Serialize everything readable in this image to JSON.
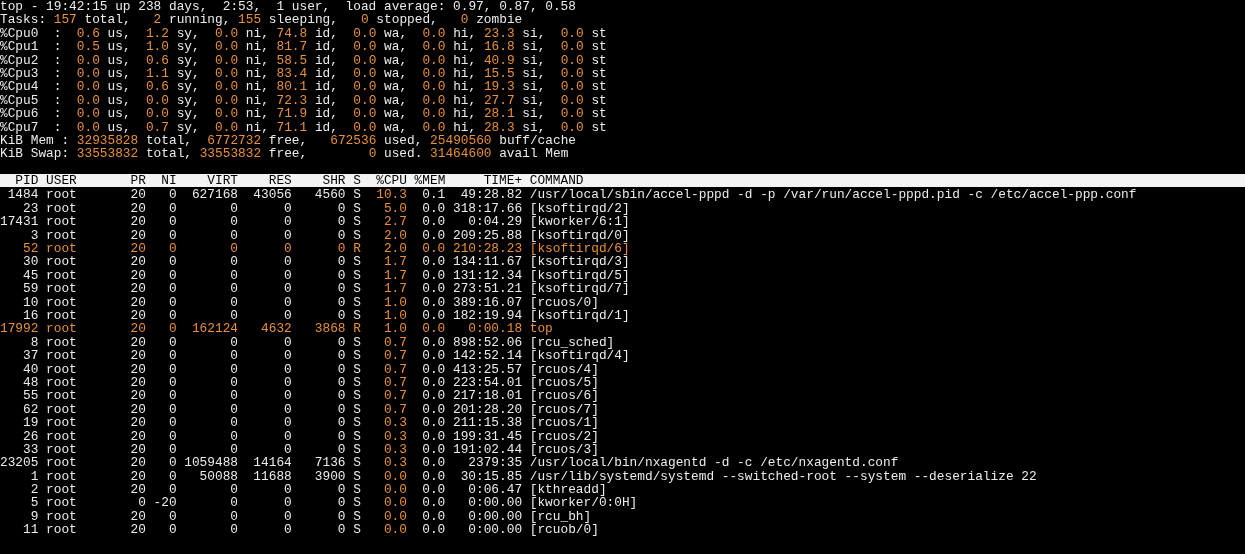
{
  "summary": [
    {
      "parts": [
        {
          "text": "top - 19:42:15 up 238 days,  2:53,  1 user,  load average: 0.97, 0.87, 0.58",
          "highlight": false
        }
      ]
    },
    {
      "parts": [
        {
          "text": "Tasks: ",
          "highlight": false
        },
        {
          "text": "157",
          "highlight": true
        },
        {
          "text": " total,   ",
          "highlight": false
        },
        {
          "text": "2",
          "highlight": true
        },
        {
          "text": " running, ",
          "highlight": false
        },
        {
          "text": "155",
          "highlight": true
        },
        {
          "text": " sleeping,   ",
          "highlight": false
        },
        {
          "text": "0",
          "highlight": true
        },
        {
          "text": " stopped,   ",
          "highlight": false
        },
        {
          "text": "0",
          "highlight": true
        },
        {
          "text": " zombie",
          "highlight": false
        }
      ]
    },
    {
      "parts": [
        {
          "text": "%Cpu0  :  ",
          "highlight": false
        },
        {
          "text": "0.6",
          "highlight": true
        },
        {
          "text": " us,  ",
          "highlight": false
        },
        {
          "text": "1.2",
          "highlight": true
        },
        {
          "text": " sy,  ",
          "highlight": false
        },
        {
          "text": "0.0",
          "highlight": true
        },
        {
          "text": " ni, ",
          "highlight": false
        },
        {
          "text": "74.8",
          "highlight": true
        },
        {
          "text": " id,  ",
          "highlight": false
        },
        {
          "text": "0.0",
          "highlight": true
        },
        {
          "text": " wa,  ",
          "highlight": false
        },
        {
          "text": "0.0",
          "highlight": true
        },
        {
          "text": " hi, ",
          "highlight": false
        },
        {
          "text": "23.3",
          "highlight": true
        },
        {
          "text": " si,  ",
          "highlight": false
        },
        {
          "text": "0.0",
          "highlight": true
        },
        {
          "text": " st",
          "highlight": false
        }
      ]
    },
    {
      "parts": [
        {
          "text": "%Cpu1  :  ",
          "highlight": false
        },
        {
          "text": "0.5",
          "highlight": true
        },
        {
          "text": " us,  ",
          "highlight": false
        },
        {
          "text": "1.0",
          "highlight": true
        },
        {
          "text": " sy,  ",
          "highlight": false
        },
        {
          "text": "0.0",
          "highlight": true
        },
        {
          "text": " ni, ",
          "highlight": false
        },
        {
          "text": "81.7",
          "highlight": true
        },
        {
          "text": " id,  ",
          "highlight": false
        },
        {
          "text": "0.0",
          "highlight": true
        },
        {
          "text": " wa,  ",
          "highlight": false
        },
        {
          "text": "0.0",
          "highlight": true
        },
        {
          "text": " hi, ",
          "highlight": false
        },
        {
          "text": "16.8",
          "highlight": true
        },
        {
          "text": " si,  ",
          "highlight": false
        },
        {
          "text": "0.0",
          "highlight": true
        },
        {
          "text": " st",
          "highlight": false
        }
      ]
    },
    {
      "parts": [
        {
          "text": "%Cpu2  :  ",
          "highlight": false
        },
        {
          "text": "0.0",
          "highlight": true
        },
        {
          "text": " us,  ",
          "highlight": false
        },
        {
          "text": "0.6",
          "highlight": true
        },
        {
          "text": " sy,  ",
          "highlight": false
        },
        {
          "text": "0.0",
          "highlight": true
        },
        {
          "text": " ni, ",
          "highlight": false
        },
        {
          "text": "58.5",
          "highlight": true
        },
        {
          "text": " id,  ",
          "highlight": false
        },
        {
          "text": "0.0",
          "highlight": true
        },
        {
          "text": " wa,  ",
          "highlight": false
        },
        {
          "text": "0.0",
          "highlight": true
        },
        {
          "text": " hi, ",
          "highlight": false
        },
        {
          "text": "40.9",
          "highlight": true
        },
        {
          "text": " si,  ",
          "highlight": false
        },
        {
          "text": "0.0",
          "highlight": true
        },
        {
          "text": " st",
          "highlight": false
        }
      ]
    },
    {
      "parts": [
        {
          "text": "%Cpu3  :  ",
          "highlight": false
        },
        {
          "text": "0.0",
          "highlight": true
        },
        {
          "text": " us,  ",
          "highlight": false
        },
        {
          "text": "1.1",
          "highlight": true
        },
        {
          "text": " sy,  ",
          "highlight": false
        },
        {
          "text": "0.0",
          "highlight": true
        },
        {
          "text": " ni, ",
          "highlight": false
        },
        {
          "text": "83.4",
          "highlight": true
        },
        {
          "text": " id,  ",
          "highlight": false
        },
        {
          "text": "0.0",
          "highlight": true
        },
        {
          "text": " wa,  ",
          "highlight": false
        },
        {
          "text": "0.0",
          "highlight": true
        },
        {
          "text": " hi, ",
          "highlight": false
        },
        {
          "text": "15.5",
          "highlight": true
        },
        {
          "text": " si,  ",
          "highlight": false
        },
        {
          "text": "0.0",
          "highlight": true
        },
        {
          "text": " st",
          "highlight": false
        }
      ]
    },
    {
      "parts": [
        {
          "text": "%Cpu4  :  ",
          "highlight": false
        },
        {
          "text": "0.0",
          "highlight": true
        },
        {
          "text": " us,  ",
          "highlight": false
        },
        {
          "text": "0.6",
          "highlight": true
        },
        {
          "text": " sy,  ",
          "highlight": false
        },
        {
          "text": "0.0",
          "highlight": true
        },
        {
          "text": " ni, ",
          "highlight": false
        },
        {
          "text": "80.1",
          "highlight": true
        },
        {
          "text": " id,  ",
          "highlight": false
        },
        {
          "text": "0.0",
          "highlight": true
        },
        {
          "text": " wa,  ",
          "highlight": false
        },
        {
          "text": "0.0",
          "highlight": true
        },
        {
          "text": " hi, ",
          "highlight": false
        },
        {
          "text": "19.3",
          "highlight": true
        },
        {
          "text": " si,  ",
          "highlight": false
        },
        {
          "text": "0.0",
          "highlight": true
        },
        {
          "text": " st",
          "highlight": false
        }
      ]
    },
    {
      "parts": [
        {
          "text": "%Cpu5  :  ",
          "highlight": false
        },
        {
          "text": "0.0",
          "highlight": true
        },
        {
          "text": " us,  ",
          "highlight": false
        },
        {
          "text": "0.0",
          "highlight": true
        },
        {
          "text": " sy,  ",
          "highlight": false
        },
        {
          "text": "0.0",
          "highlight": true
        },
        {
          "text": " ni, ",
          "highlight": false
        },
        {
          "text": "72.3",
          "highlight": true
        },
        {
          "text": " id,  ",
          "highlight": false
        },
        {
          "text": "0.0",
          "highlight": true
        },
        {
          "text": " wa,  ",
          "highlight": false
        },
        {
          "text": "0.0",
          "highlight": true
        },
        {
          "text": " hi, ",
          "highlight": false
        },
        {
          "text": "27.7",
          "highlight": true
        },
        {
          "text": " si,  ",
          "highlight": false
        },
        {
          "text": "0.0",
          "highlight": true
        },
        {
          "text": " st",
          "highlight": false
        }
      ]
    },
    {
      "parts": [
        {
          "text": "%Cpu6  :  ",
          "highlight": false
        },
        {
          "text": "0.0",
          "highlight": true
        },
        {
          "text": " us,  ",
          "highlight": false
        },
        {
          "text": "0.0",
          "highlight": true
        },
        {
          "text": " sy,  ",
          "highlight": false
        },
        {
          "text": "0.0",
          "highlight": true
        },
        {
          "text": " ni, ",
          "highlight": false
        },
        {
          "text": "71.9",
          "highlight": true
        },
        {
          "text": " id,  ",
          "highlight": false
        },
        {
          "text": "0.0",
          "highlight": true
        },
        {
          "text": " wa,  ",
          "highlight": false
        },
        {
          "text": "0.0",
          "highlight": true
        },
        {
          "text": " hi, ",
          "highlight": false
        },
        {
          "text": "28.1",
          "highlight": true
        },
        {
          "text": " si,  ",
          "highlight": false
        },
        {
          "text": "0.0",
          "highlight": true
        },
        {
          "text": " st",
          "highlight": false
        }
      ]
    },
    {
      "parts": [
        {
          "text": "%Cpu7  :  ",
          "highlight": false
        },
        {
          "text": "0.0",
          "highlight": true
        },
        {
          "text": " us,  ",
          "highlight": false
        },
        {
          "text": "0.7",
          "highlight": true
        },
        {
          "text": " sy,  ",
          "highlight": false
        },
        {
          "text": "0.0",
          "highlight": true
        },
        {
          "text": " ni, ",
          "highlight": false
        },
        {
          "text": "71.1",
          "highlight": true
        },
        {
          "text": " id,  ",
          "highlight": false
        },
        {
          "text": "0.0",
          "highlight": true
        },
        {
          "text": " wa,  ",
          "highlight": false
        },
        {
          "text": "0.0",
          "highlight": true
        },
        {
          "text": " hi, ",
          "highlight": false
        },
        {
          "text": "28.3",
          "highlight": true
        },
        {
          "text": " si,  ",
          "highlight": false
        },
        {
          "text": "0.0",
          "highlight": true
        },
        {
          "text": " st",
          "highlight": false
        }
      ]
    },
    {
      "parts": [
        {
          "text": "KiB Mem : ",
          "highlight": false
        },
        {
          "text": "32935828",
          "highlight": true
        },
        {
          "text": " total,  ",
          "highlight": false
        },
        {
          "text": "6772732",
          "highlight": true
        },
        {
          "text": " free,   ",
          "highlight": false
        },
        {
          "text": "672536",
          "highlight": true
        },
        {
          "text": " used, ",
          "highlight": false
        },
        {
          "text": "25490560",
          "highlight": true
        },
        {
          "text": " buff/cache",
          "highlight": false
        }
      ]
    },
    {
      "parts": [
        {
          "text": "KiB Swap: ",
          "highlight": false
        },
        {
          "text": "33553832",
          "highlight": true
        },
        {
          "text": " total, ",
          "highlight": false
        },
        {
          "text": "33553832",
          "highlight": true
        },
        {
          "text": " free,        ",
          "highlight": false
        },
        {
          "text": "0",
          "highlight": true
        },
        {
          "text": " used. ",
          "highlight": false
        },
        {
          "text": "31464600",
          "highlight": true
        },
        {
          "text": " avail Mem",
          "highlight": false
        }
      ]
    }
  ],
  "table": {
    "columns": [
      {
        "label": "PID",
        "accent": false
      },
      {
        "label": "USER",
        "accent": false
      },
      {
        "label": "PR",
        "accent": false
      },
      {
        "label": "NI",
        "accent": false
      },
      {
        "label": "VIRT",
        "accent": false
      },
      {
        "label": "RES",
        "accent": false
      },
      {
        "label": "SHR",
        "accent": false
      },
      {
        "label": "S",
        "accent": false
      },
      {
        "label": "%CPU",
        "accent": true
      },
      {
        "label": "%MEM",
        "accent": false
      },
      {
        "label": "TIME+",
        "accent": false
      },
      {
        "label": "COMMAND",
        "accent": false
      }
    ],
    "rows": [
      {
        "highlighted": false,
        "cells": [
          "1484",
          "root",
          "20",
          "0",
          "627168",
          "43056",
          "4560",
          "S",
          "10.3",
          "0.1",
          "49:28.82",
          "/usr/local/sbin/accel-pppd -d -p /var/run/accel-pppd.pid -c /etc/accel-ppp.conf"
        ]
      },
      {
        "highlighted": false,
        "cells": [
          "23",
          "root",
          "20",
          "0",
          "0",
          "0",
          "0",
          "S",
          "5.0",
          "0.0",
          "318:17.66",
          "[ksoftirqd/2]"
        ]
      },
      {
        "highlighted": false,
        "cells": [
          "17431",
          "root",
          "20",
          "0",
          "0",
          "0",
          "0",
          "S",
          "2.7",
          "0.0",
          "0:04.29",
          "[kworker/6:1]"
        ]
      },
      {
        "highlighted": false,
        "cells": [
          "3",
          "root",
          "20",
          "0",
          "0",
          "0",
          "0",
          "S",
          "2.0",
          "0.0",
          "209:25.88",
          "[ksoftirqd/0]"
        ]
      },
      {
        "highlighted": true,
        "cells": [
          "52",
          "root",
          "20",
          "0",
          "0",
          "0",
          "0",
          "R",
          "2.0",
          "0.0",
          "210:28.23",
          "[ksoftirqd/6]"
        ]
      },
      {
        "highlighted": false,
        "cells": [
          "30",
          "root",
          "20",
          "0",
          "0",
          "0",
          "0",
          "S",
          "1.7",
          "0.0",
          "134:11.67",
          "[ksoftirqd/3]"
        ]
      },
      {
        "highlighted": false,
        "cells": [
          "45",
          "root",
          "20",
          "0",
          "0",
          "0",
          "0",
          "S",
          "1.7",
          "0.0",
          "131:12.34",
          "[ksoftirqd/5]"
        ]
      },
      {
        "highlighted": false,
        "cells": [
          "59",
          "root",
          "20",
          "0",
          "0",
          "0",
          "0",
          "S",
          "1.7",
          "0.0",
          "273:51.21",
          "[ksoftirqd/7]"
        ]
      },
      {
        "highlighted": false,
        "cells": [
          "10",
          "root",
          "20",
          "0",
          "0",
          "0",
          "0",
          "S",
          "1.0",
          "0.0",
          "389:16.07",
          "[rcuos/0]"
        ]
      },
      {
        "highlighted": false,
        "cells": [
          "16",
          "root",
          "20",
          "0",
          "0",
          "0",
          "0",
          "S",
          "1.0",
          "0.0",
          "182:19.94",
          "[ksoftirqd/1]"
        ]
      },
      {
        "highlighted": true,
        "cells": [
          "17992",
          "root",
          "20",
          "0",
          "162124",
          "4632",
          "3868",
          "R",
          "1.0",
          "0.0",
          "0:00.18",
          "top"
        ]
      },
      {
        "highlighted": false,
        "cells": [
          "8",
          "root",
          "20",
          "0",
          "0",
          "0",
          "0",
          "S",
          "0.7",
          "0.0",
          "898:52.06",
          "[rcu_sched]"
        ]
      },
      {
        "highlighted": false,
        "cells": [
          "37",
          "root",
          "20",
          "0",
          "0",
          "0",
          "0",
          "S",
          "0.7",
          "0.0",
          "142:52.14",
          "[ksoftirqd/4]"
        ]
      },
      {
        "highlighted": false,
        "cells": [
          "40",
          "root",
          "20",
          "0",
          "0",
          "0",
          "0",
          "S",
          "0.7",
          "0.0",
          "413:25.57",
          "[rcuos/4]"
        ]
      },
      {
        "highlighted": false,
        "cells": [
          "48",
          "root",
          "20",
          "0",
          "0",
          "0",
          "0",
          "S",
          "0.7",
          "0.0",
          "223:54.01",
          "[rcuos/5]"
        ]
      },
      {
        "highlighted": false,
        "cells": [
          "55",
          "root",
          "20",
          "0",
          "0",
          "0",
          "0",
          "S",
          "0.7",
          "0.0",
          "217:18.01",
          "[rcuos/6]"
        ]
      },
      {
        "highlighted": false,
        "cells": [
          "62",
          "root",
          "20",
          "0",
          "0",
          "0",
          "0",
          "S",
          "0.7",
          "0.0",
          "201:28.20",
          "[rcuos/7]"
        ]
      },
      {
        "highlighted": false,
        "cells": [
          "19",
          "root",
          "20",
          "0",
          "0",
          "0",
          "0",
          "S",
          "0.3",
          "0.0",
          "211:15.38",
          "[rcuos/1]"
        ]
      },
      {
        "highlighted": false,
        "cells": [
          "26",
          "root",
          "20",
          "0",
          "0",
          "0",
          "0",
          "S",
          "0.3",
          "0.0",
          "199:31.45",
          "[rcuos/2]"
        ]
      },
      {
        "highlighted": false,
        "cells": [
          "33",
          "root",
          "20",
          "0",
          "0",
          "0",
          "0",
          "S",
          "0.3",
          "0.0",
          "191:02.44",
          "[rcuos/3]"
        ]
      },
      {
        "highlighted": false,
        "cells": [
          "23205",
          "root",
          "20",
          "0",
          "1059488",
          "14164",
          "7136",
          "S",
          "0.3",
          "0.0",
          "2379:35",
          "/usr/local/bin/nxagentd -d -c /etc/nxagentd.conf"
        ]
      },
      {
        "highlighted": false,
        "cells": [
          "1",
          "root",
          "20",
          "0",
          "50088",
          "11688",
          "3900",
          "S",
          "0.0",
          "0.0",
          "30:15.85",
          "/usr/lib/systemd/systemd --switched-root --system --deserialize 22"
        ]
      },
      {
        "highlighted": false,
        "cells": [
          "2",
          "root",
          "20",
          "0",
          "0",
          "0",
          "0",
          "S",
          "0.0",
          "0.0",
          "0:06.47",
          "[kthreadd]"
        ]
      },
      {
        "highlighted": false,
        "cells": [
          "5",
          "root",
          "0",
          "-20",
          "0",
          "0",
          "0",
          "S",
          "0.0",
          "0.0",
          "0:00.00",
          "[kworker/0:0H]"
        ]
      },
      {
        "highlighted": false,
        "cells": [
          "9",
          "root",
          "20",
          "0",
          "0",
          "0",
          "0",
          "S",
          "0.0",
          "0.0",
          "0:00.00",
          "[rcu_bh]"
        ]
      },
      {
        "highlighted": false,
        "cells": [
          "11",
          "root",
          "20",
          "0",
          "0",
          "0",
          "0",
          "S",
          "0.0",
          "0.0",
          "0:00.00",
          "[rcuob/0]"
        ]
      }
    ]
  }
}
